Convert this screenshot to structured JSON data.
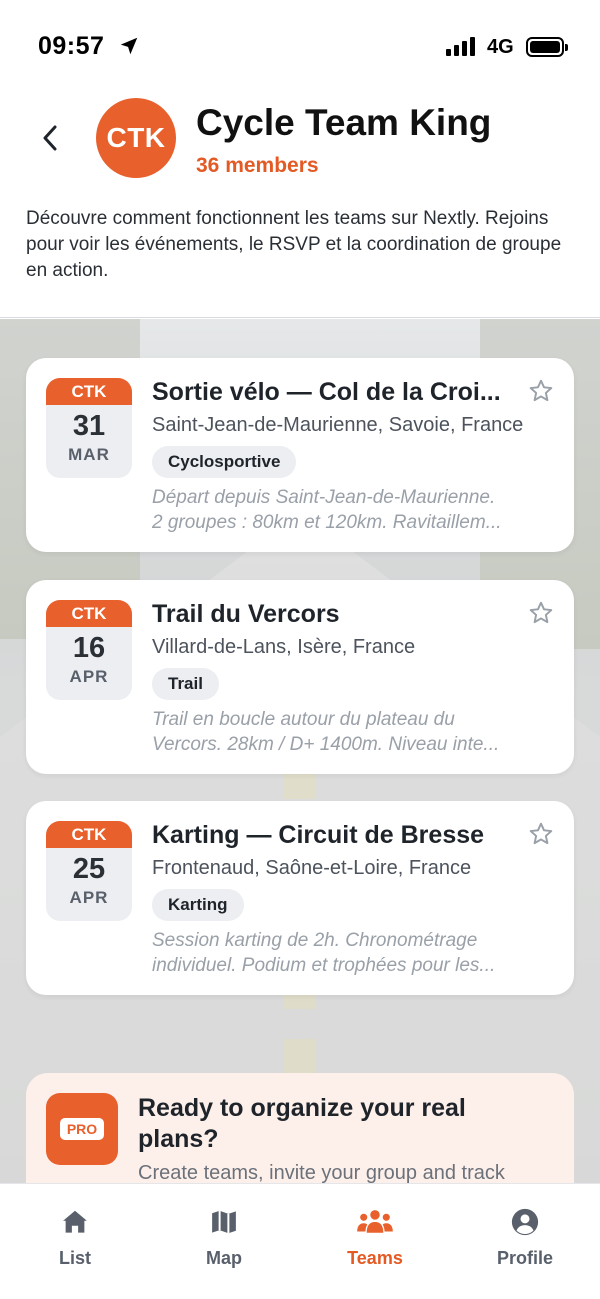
{
  "status_bar": {
    "time": "09:57",
    "network": "4G"
  },
  "header": {
    "avatar_initials": "CTK",
    "title": "Cycle Team King",
    "members": "36 members",
    "description": "Découvre comment fonctionnent les teams sur Nextly. Rejoins pour voir les événements, le RSVP et la coordination de groupe en action."
  },
  "events": [
    {
      "badge": "CTK",
      "day": "31",
      "month": "MAR",
      "title": "Sortie vélo — Col de la Croi...",
      "location": "Saint-Jean-de-Maurienne, Savoie, France",
      "tag": "Cyclosportive",
      "desc_line1": "Départ depuis Saint-Jean-de-Maurienne.",
      "desc_line2": "2 groupes : 80km et 120km. Ravitaillem..."
    },
    {
      "badge": "CTK",
      "day": "16",
      "month": "APR",
      "title": "Trail du Vercors",
      "location": "Villard-de-Lans, Isère, France",
      "tag": "Trail",
      "desc_line1": "Trail en boucle autour du plateau du",
      "desc_line2": "Vercors. 28km / D+ 1400m. Niveau inte..."
    },
    {
      "badge": "CTK",
      "day": "25",
      "month": "APR",
      "title": "Karting — Circuit de Bresse",
      "location": "Frontenaud, Saône-et-Loire, France",
      "tag": "Karting",
      "desc_line1": "Session karting de 2h. Chronométrage",
      "desc_line2": "individuel. Podium et trophées pour les..."
    }
  ],
  "promo": {
    "icon_label": "PRO",
    "title": "Ready to organize your real plans?",
    "subtitle": "Create teams, invite your group and track"
  },
  "tabs": [
    {
      "label": "List",
      "icon": "home-icon",
      "active": false
    },
    {
      "label": "Map",
      "icon": "map-icon",
      "active": false
    },
    {
      "label": "Teams",
      "icon": "teams-icon",
      "active": true
    },
    {
      "label": "Profile",
      "icon": "profile-icon",
      "active": false
    }
  ],
  "colors": {
    "accent": "#e8602c",
    "accent_text": "#e35a24"
  }
}
